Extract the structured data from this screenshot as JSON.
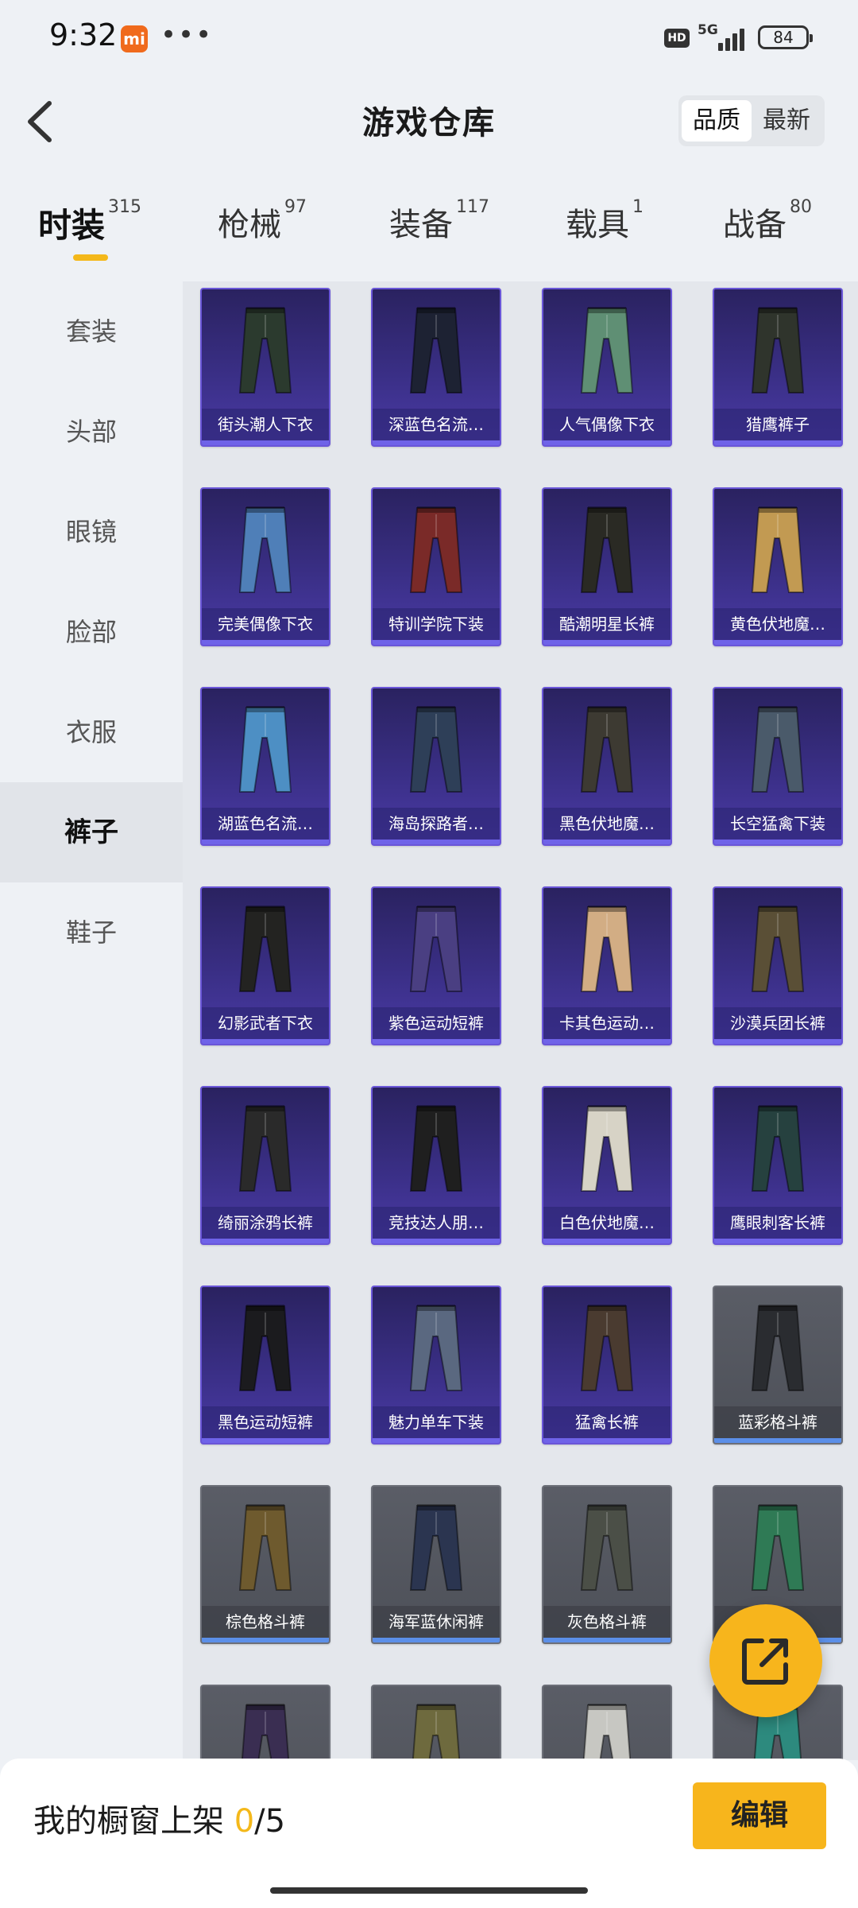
{
  "status": {
    "time": "9:32",
    "mi_badge": "mi",
    "dots": "•••",
    "hd": "HD",
    "net": "5G",
    "battery": "84"
  },
  "header": {
    "title": "游戏仓库",
    "sort_active": "品质",
    "sort_inactive": "最新"
  },
  "tabs": [
    {
      "label": "时装",
      "count": "315"
    },
    {
      "label": "枪械",
      "count": "97"
    },
    {
      "label": "装备",
      "count": "117"
    },
    {
      "label": "载具",
      "count": "1"
    },
    {
      "label": "战备",
      "count": "80"
    }
  ],
  "sidebar": [
    "套装",
    "头部",
    "眼镜",
    "脸部",
    "衣服",
    "裤子",
    "鞋子"
  ],
  "items": [
    {
      "name": "街头潮人下衣",
      "rarity": "purple",
      "color": "#2b3a2e"
    },
    {
      "name": "深蓝色名流…",
      "rarity": "purple",
      "color": "#1d2233"
    },
    {
      "name": "人气偶像下衣",
      "rarity": "purple",
      "color": "#5f8f74"
    },
    {
      "name": "猎鹰裤子",
      "rarity": "purple",
      "color": "#2f342c"
    },
    {
      "name": "完美偶像下衣",
      "rarity": "purple",
      "color": "#4f7fb8"
    },
    {
      "name": "特训学院下装",
      "rarity": "purple",
      "color": "#7a2a28"
    },
    {
      "name": "酷潮明星长裤",
      "rarity": "purple",
      "color": "#2a2a24"
    },
    {
      "name": "黄色伏地魔…",
      "rarity": "purple",
      "color": "#c29a52"
    },
    {
      "name": "湖蓝色名流…",
      "rarity": "purple",
      "color": "#4d8fc4"
    },
    {
      "name": "海岛探路者…",
      "rarity": "purple",
      "color": "#2e3f58"
    },
    {
      "name": "黑色伏地魔…",
      "rarity": "purple",
      "color": "#3d3a32"
    },
    {
      "name": "长空猛禽下装",
      "rarity": "purple",
      "color": "#4a5a6a"
    },
    {
      "name": "幻影武者下衣",
      "rarity": "purple",
      "color": "#232321"
    },
    {
      "name": "紫色运动短裤",
      "rarity": "purple",
      "color": "#4a3f82"
    },
    {
      "name": "卡其色运动…",
      "rarity": "purple",
      "color": "#d2ad84"
    },
    {
      "name": "沙漠兵团长裤",
      "rarity": "purple",
      "color": "#5a4f36"
    },
    {
      "name": "绮丽涂鸦长裤",
      "rarity": "purple",
      "color": "#2a2a2a"
    },
    {
      "name": "竞技达人朋…",
      "rarity": "purple",
      "color": "#1f1f1f"
    },
    {
      "name": "白色伏地魔…",
      "rarity": "purple",
      "color": "#d7d3c6"
    },
    {
      "name": "鹰眼刺客长裤",
      "rarity": "purple",
      "color": "#26413f"
    },
    {
      "name": "黑色运动短裤",
      "rarity": "purple",
      "color": "#1b1b1e"
    },
    {
      "name": "魅力单车下装",
      "rarity": "purple",
      "color": "#5a6880"
    },
    {
      "name": "猛禽长裤",
      "rarity": "purple",
      "color": "#4a3b30"
    },
    {
      "name": "蓝彩格斗裤",
      "rarity": "gray",
      "color": "#2a2c30"
    },
    {
      "name": "棕色格斗裤",
      "rarity": "gray",
      "color": "#6e5a2e"
    },
    {
      "name": "海军蓝休闲裤",
      "rarity": "gray",
      "color": "#2b3550"
    },
    {
      "name": "灰色格斗裤",
      "rarity": "gray",
      "color": "#4b4f47"
    },
    {
      "name": "…",
      "rarity": "gray",
      "color": "#2f7a55"
    },
    {
      "name": "",
      "rarity": "gray",
      "color": "#3a2e52"
    },
    {
      "name": "",
      "rarity": "gray",
      "color": "#6e6a3e"
    },
    {
      "name": "",
      "rarity": "gray",
      "color": "#c7c7c2"
    },
    {
      "name": "",
      "rarity": "gray",
      "color": "#2d8a7e"
    }
  ],
  "bottom": {
    "shelf_label": "我的橱窗上架",
    "shelf_count": "0",
    "shelf_total": "/5",
    "edit_label": "编辑"
  },
  "colors": {
    "accent": "#f7b51c",
    "purple_bar": "#6f63e8",
    "gray_bar": "#5b8fe8"
  }
}
